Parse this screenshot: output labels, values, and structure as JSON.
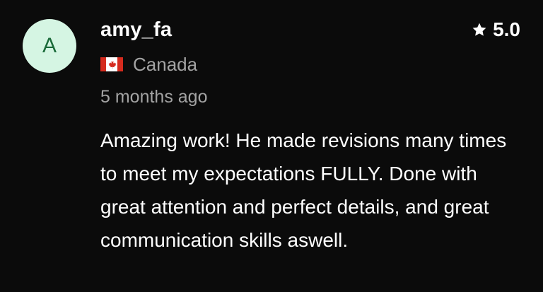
{
  "review": {
    "avatar_letter": "A",
    "username": "amy_fa",
    "rating": "5.0",
    "country": "Canada",
    "time_ago": "5 months ago",
    "text": "Amazing work! He made revisions many times to meet my expectations FULLY. Done with great attention and perfect details, and great communication skills aswell.",
    "icons": {
      "star": "star-icon",
      "flag": "canada-flag-icon"
    },
    "colors": {
      "background": "#0b0b0b",
      "avatar_bg": "#d5f5e3",
      "avatar_letter": "#1b6b3a",
      "muted_text": "#a3a3a3",
      "primary_text": "#ffffff",
      "flag_red": "#d52b1e"
    }
  }
}
